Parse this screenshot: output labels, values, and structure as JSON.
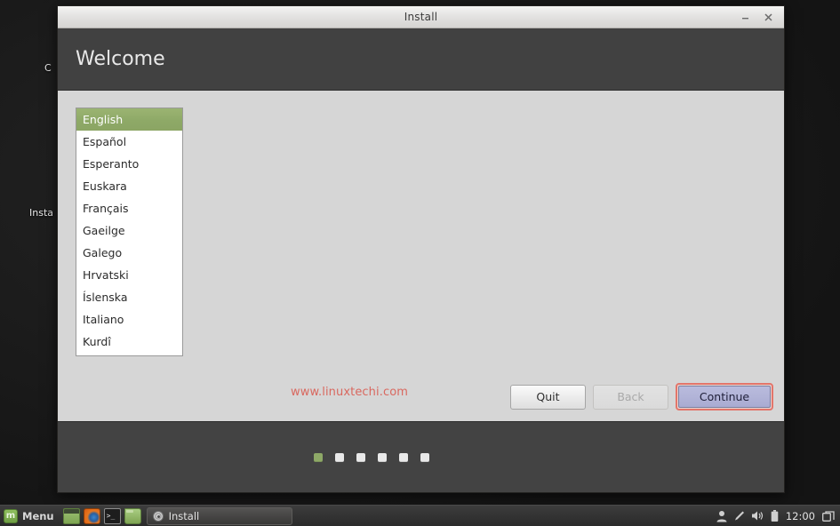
{
  "desktop": {
    "icons": [
      {
        "name": "computer-desktop-icon",
        "label": "C"
      },
      {
        "name": "install-desktop-icon",
        "label": "Insta"
      }
    ]
  },
  "window": {
    "title": "Install",
    "page_title": "Welcome",
    "minimize_label": "–",
    "close_label": "×",
    "watermark": "www.linuxtechi.com",
    "header_bg": "#414141",
    "body_bg": "#d6d6d6",
    "footer_bg": "#434343"
  },
  "language_list": {
    "selected": "English",
    "selected_bg": "#8ea967",
    "items": [
      {
        "label": "English",
        "selected": true
      },
      {
        "label": "Español",
        "selected": false
      },
      {
        "label": "Esperanto",
        "selected": false
      },
      {
        "label": "Euskara",
        "selected": false
      },
      {
        "label": "Français",
        "selected": false
      },
      {
        "label": "Gaeilge",
        "selected": false
      },
      {
        "label": "Galego",
        "selected": false
      },
      {
        "label": "Hrvatski",
        "selected": false
      },
      {
        "label": "Íslenska",
        "selected": false
      },
      {
        "label": "Italiano",
        "selected": false
      },
      {
        "label": "Kurdî",
        "selected": false
      }
    ]
  },
  "nav_buttons": {
    "quit": "Quit",
    "back": "Back",
    "back_disabled": true,
    "continue": "Continue",
    "continue_focus_color": "#e3756a",
    "continue_fill": "#b2b4d8"
  },
  "steps": {
    "total": 6,
    "current": 1,
    "active_color": "#8ea967",
    "inactive_color": "#e9e9e9"
  },
  "taskbar": {
    "menu_label": "Menu",
    "mint_logo_glyph": "m",
    "launchers": [
      {
        "name": "show-desktop-icon",
        "title": "Show Desktop"
      },
      {
        "name": "firefox-icon",
        "title": "Firefox Web Browser"
      },
      {
        "name": "terminal-icon",
        "title": "Terminal",
        "glyph": ">_"
      },
      {
        "name": "file-manager-icon",
        "title": "Files"
      }
    ],
    "window_buttons": [
      {
        "name": "task-install",
        "label": "Install",
        "icon": "disc-icon",
        "active": true
      }
    ],
    "tray": {
      "clock": "12:00",
      "icons": [
        {
          "name": "user-icon"
        },
        {
          "name": "pen-icon"
        },
        {
          "name": "volume-icon"
        },
        {
          "name": "battery-icon"
        },
        {
          "name": "window-switcher-icon"
        }
      ]
    }
  }
}
